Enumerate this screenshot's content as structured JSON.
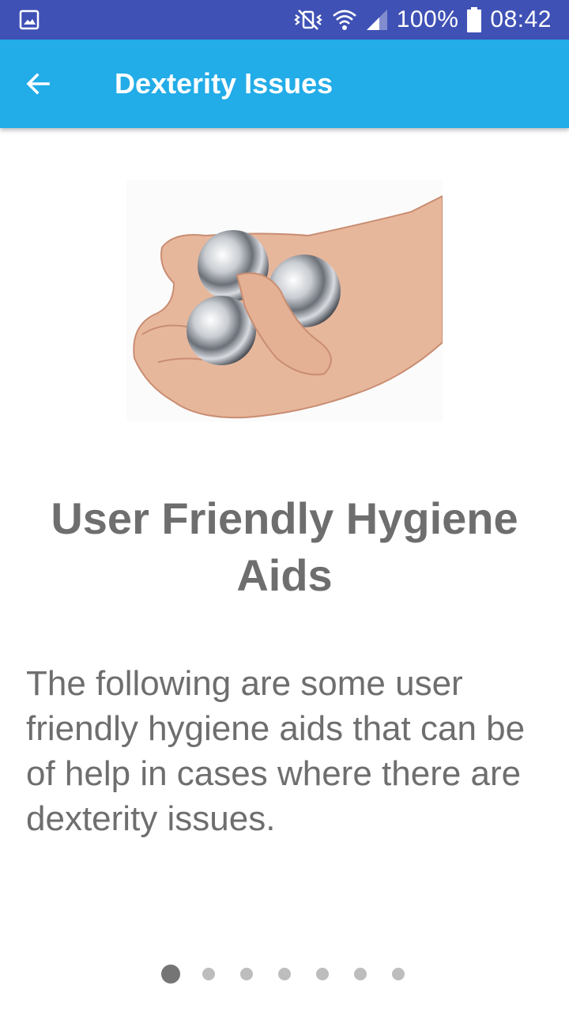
{
  "status_bar": {
    "battery": "100%",
    "time": "08:42",
    "icons": [
      "gallery-icon",
      "vibrate-mute-icon",
      "wifi-icon",
      "signal-icon",
      "battery-icon"
    ]
  },
  "app_bar": {
    "title": "Dexterity Issues",
    "back_icon": "arrow-back-icon",
    "color": "#22ace8"
  },
  "content": {
    "image": "hand-holding-chrome-balls",
    "headline": "User Friendly Hygiene Aids",
    "body": "The following are some user friendly hygiene aids that can be of help in cases where there are dexterity issues."
  },
  "pager": {
    "total_pages": 7,
    "current_page": 1
  },
  "colors": {
    "status_bar": "#3f51b5",
    "text": "#6e6e6e",
    "dot_active": "#757575",
    "dot_inactive": "#bdbdbd"
  }
}
